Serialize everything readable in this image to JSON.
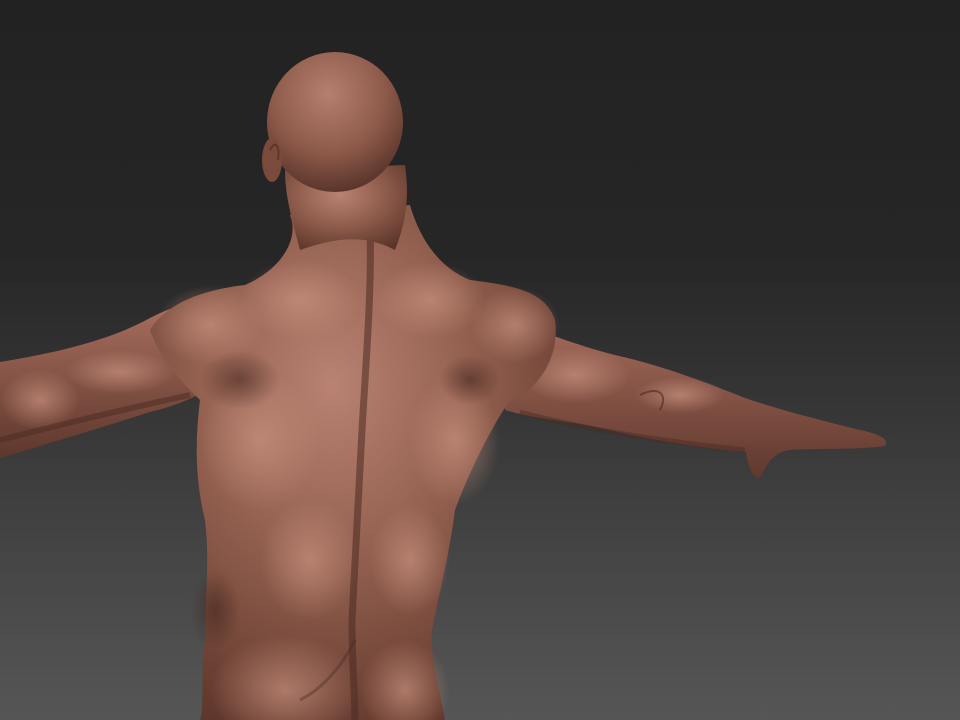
{
  "scene": {
    "subject": "sculpted-male-torso-back-view",
    "material_color": "#8e5a4b",
    "highlight_color": "#c08a78",
    "shadow_color": "#4a2a22",
    "background_top": "#222222",
    "background_bottom": "#565656"
  }
}
